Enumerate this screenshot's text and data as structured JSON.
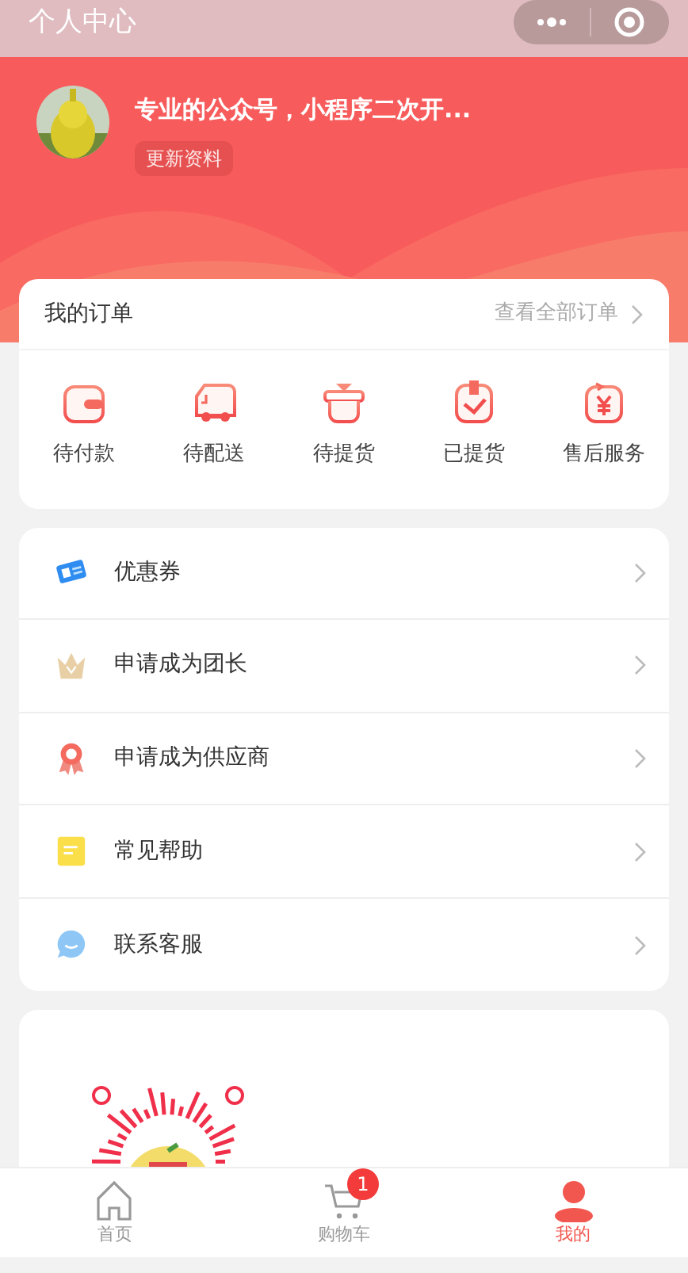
{
  "top_bar": {
    "title": "个人中心"
  },
  "profile": {
    "name": "专业的公众号，小程序二次开...",
    "edit_button": "更新资料"
  },
  "orders": {
    "title": "我的订单",
    "view_all": "查看全部订单",
    "items": [
      {
        "label": "待付款"
      },
      {
        "label": "待配送"
      },
      {
        "label": "待提货"
      },
      {
        "label": "已提货"
      },
      {
        "label": "售后服务"
      }
    ]
  },
  "menu": [
    {
      "label": "优惠券"
    },
    {
      "label": "申请成为团长"
    },
    {
      "label": "申请成为供应商"
    },
    {
      "label": "常见帮助"
    },
    {
      "label": "联系客服"
    }
  ],
  "tabs": [
    {
      "label": "首页",
      "selected": false
    },
    {
      "label": "购物车",
      "selected": false,
      "badge": "1"
    },
    {
      "label": "我的",
      "selected": true
    }
  ]
}
